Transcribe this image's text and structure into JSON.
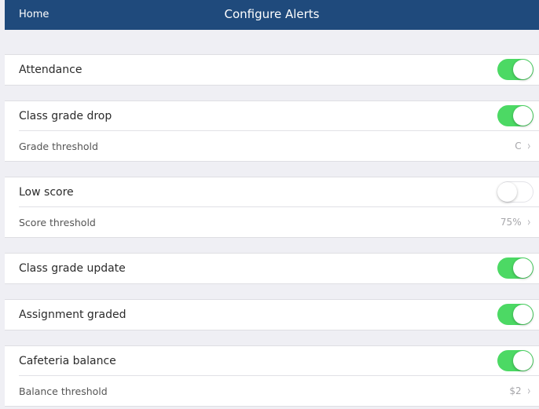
{
  "colors": {
    "nav_background": "#1f4a7c",
    "toggle_on": "#4cd964",
    "page_background": "#efeff4"
  },
  "nav": {
    "back_label": "Home",
    "title": "Configure Alerts"
  },
  "groups": [
    {
      "toggle": {
        "label": "Attendance",
        "enabled": true
      }
    },
    {
      "toggle": {
        "label": "Class grade drop",
        "enabled": true
      },
      "threshold": {
        "label": "Grade threshold",
        "value": "C"
      }
    },
    {
      "toggle": {
        "label": "Low score",
        "enabled": false
      },
      "threshold": {
        "label": "Score threshold",
        "value": "75%"
      }
    },
    {
      "toggle": {
        "label": "Class grade update",
        "enabled": true
      }
    },
    {
      "toggle": {
        "label": "Assignment graded",
        "enabled": true
      }
    },
    {
      "toggle": {
        "label": "Cafeteria balance",
        "enabled": true
      },
      "threshold": {
        "label": "Balance threshold",
        "value": "$2"
      }
    }
  ],
  "icons": {
    "disclosure": "chevron-right-icon"
  }
}
